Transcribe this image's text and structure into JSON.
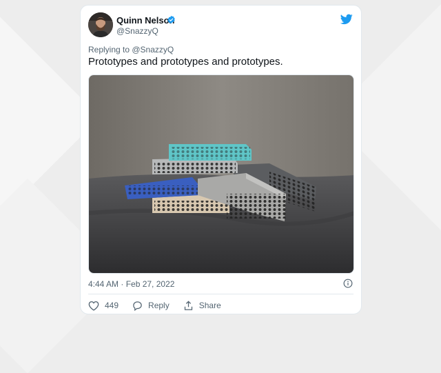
{
  "author": {
    "name": "Quinn Nelson",
    "handle": "@SnazzyQ",
    "verified": true
  },
  "replying_to": "Replying to @SnazzyQ",
  "tweet": {
    "text": "Prototypes and prototypes and prototypes.",
    "timestamp": "4:44 AM · Feb 27, 2022"
  },
  "actions": {
    "like_count": "449",
    "reply_label": "Reply",
    "share_label": "Share"
  },
  "colors": {
    "brand": "#1d9bf0",
    "text": "#0f1419",
    "secondary": "#536471"
  },
  "icons": [
    "twitter-bird-icon",
    "verified-badge-icon",
    "info-icon",
    "heart-icon",
    "reply-icon",
    "share-icon"
  ]
}
